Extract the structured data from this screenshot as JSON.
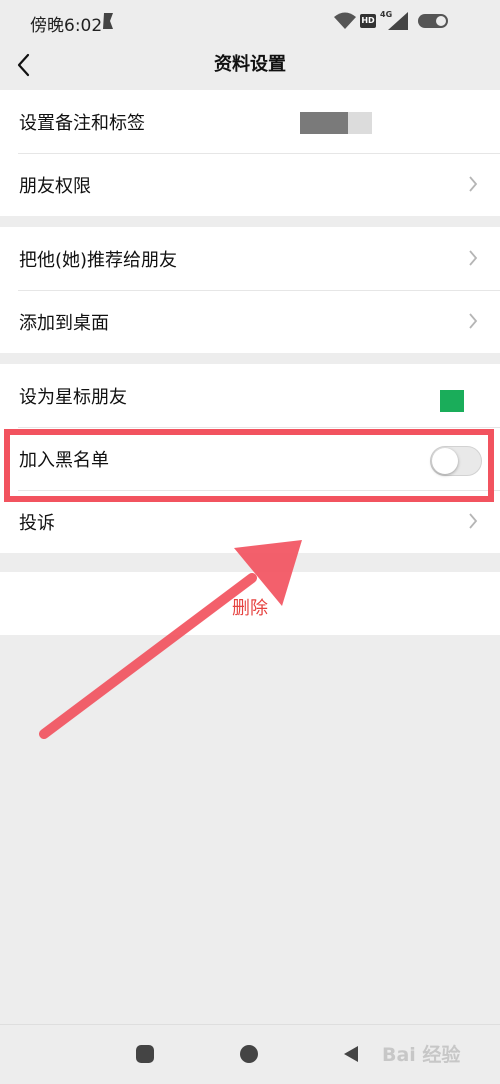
{
  "status_bar": {
    "time": "傍晚6:02",
    "icons": [
      "moon-icon",
      "wifi-icon",
      "hd-icon",
      "signal-4g-icon",
      "battery-toggle-icon"
    ],
    "hd_label": "HD",
    "network_label": "4G"
  },
  "nav": {
    "title": "资料设置",
    "back_icon": "chevron-left-icon"
  },
  "groups": [
    {
      "items": [
        {
          "label": "设置备注和标签",
          "trailing": "tag-preview"
        },
        {
          "label": "朋友权限",
          "trailing": "chevron-right-icon"
        }
      ]
    },
    {
      "items": [
        {
          "label": "把他(她)推荐给朋友",
          "trailing": "chevron-right-icon"
        },
        {
          "label": "添加到桌面",
          "trailing": "chevron-right-icon"
        }
      ]
    },
    {
      "items": [
        {
          "label": "设为星标朋友",
          "trailing": "green-square"
        },
        {
          "label": "加入黑名单",
          "trailing": "toggle",
          "toggle_on": false
        },
        {
          "label": "投诉",
          "trailing": "chevron-right-icon"
        }
      ]
    }
  ],
  "delete": {
    "label": "删除"
  },
  "colors": {
    "background": "#ededed",
    "highlight": "#f2535f",
    "delete_text": "#e64340",
    "star_green": "#1aad5a"
  },
  "system_nav": {
    "buttons": [
      "recent-apps-icon",
      "home-icon",
      "back-triangle-icon"
    ]
  },
  "watermark": {
    "text": "Bai 经验"
  }
}
